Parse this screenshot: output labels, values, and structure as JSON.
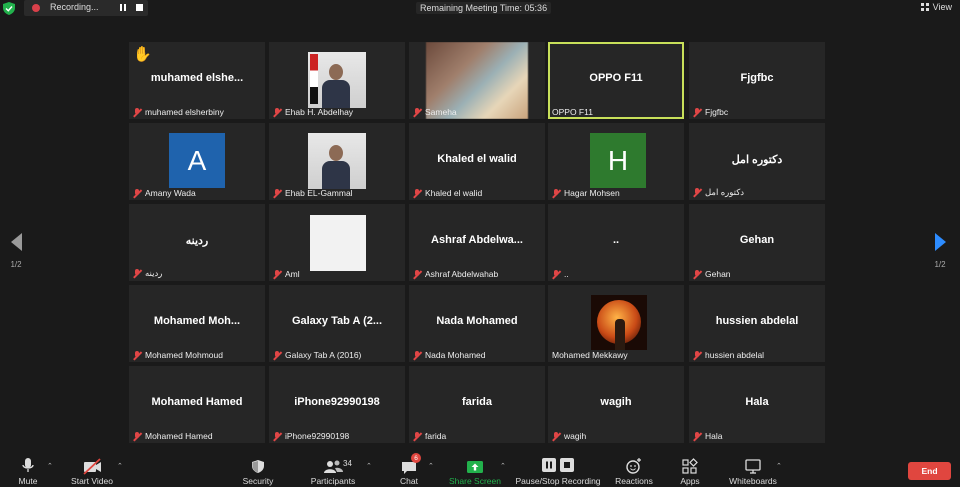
{
  "topbar": {
    "recording_label": "Recording...",
    "remaining_time": "Remaining Meeting Time: 05:36",
    "view_label": "View"
  },
  "pager": {
    "left_page": "1/2",
    "right_page": "1/2"
  },
  "tiles": [
    {
      "center": "muhamed  elshe...",
      "label": "muhamed elsherbiny",
      "hand": "✋"
    },
    {
      "center": "",
      "label": "Ehab H. Abdelhay"
    },
    {
      "center": "",
      "label": "Sameha"
    },
    {
      "center": "OPPO F11",
      "label": "OPPO F11"
    },
    {
      "center": "Fjgfbc",
      "label": "Fjgfbc"
    },
    {
      "center": "",
      "label": "Amany Wada",
      "avatar": "A",
      "avatar_color": "#1f63ad"
    },
    {
      "center": "",
      "label": "Ehab EL-Gammal"
    },
    {
      "center": "Khaled el walid",
      "label": "Khaled el walid"
    },
    {
      "center": "",
      "label": "Hagar Mohsen",
      "avatar": "H",
      "avatar_color": "#2e7a2e"
    },
    {
      "center": "دكتوره امل",
      "label": "دكتوره امل"
    },
    {
      "center": "ردينه",
      "label": "ردينه"
    },
    {
      "center": "",
      "label": "Aml"
    },
    {
      "center": "Ashraf  Abdelwa...",
      "label": "Ashraf Abdelwahab"
    },
    {
      "center": "..",
      "label": ".."
    },
    {
      "center": "Gehan",
      "label": "Gehan"
    },
    {
      "center": "Mohamed  Moh...",
      "label": "Mohamed Mohmoud"
    },
    {
      "center": "Galaxy Tab A (2...",
      "label": "Galaxy Tab A (2016)"
    },
    {
      "center": "Nada Mohamed",
      "label": "Nada Mohamed"
    },
    {
      "center": "",
      "label": "Mohamed Mekkawy"
    },
    {
      "center": "hussien abdelal",
      "label": "hussien abdelal"
    },
    {
      "center": "Mohamed Hamed",
      "label": "Mohamed Hamed"
    },
    {
      "center": "iPhone92990198",
      "label": "iPhone92990198"
    },
    {
      "center": "farida",
      "label": "farida"
    },
    {
      "center": "wagih",
      "label": "wagih"
    },
    {
      "center": "Hala",
      "label": "Hala"
    }
  ],
  "toolbar": {
    "mute": "Mute",
    "start_video": "Start Video",
    "security": "Security",
    "participants": "Participants",
    "participants_count": "34",
    "chat": "Chat",
    "chat_badge": "6",
    "share_screen": "Share Screen",
    "pause_stop_recording": "Pause/Stop Recording",
    "reactions": "Reactions",
    "apps": "Apps",
    "whiteboards": "Whiteboards",
    "end": "End"
  },
  "colors": {
    "active_border": "#c8e05a",
    "share_green": "#22b14c",
    "end_red": "#e0463f",
    "next_arrow": "#2d8cff"
  }
}
